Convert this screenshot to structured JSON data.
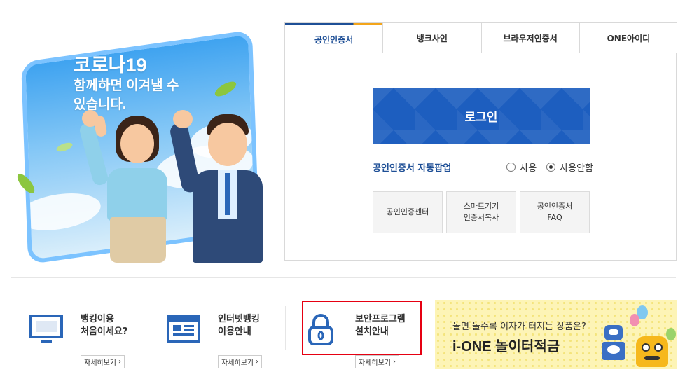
{
  "hero": {
    "line1": "코로나19",
    "line2": "함께하면 이겨낼 수",
    "line3": "있습니다."
  },
  "tabs": [
    {
      "label": "공인인증서",
      "active": true
    },
    {
      "label": "뱅크사인",
      "active": false
    },
    {
      "label": "브라우저인증서",
      "active": false
    },
    {
      "label": "ONE아이디",
      "active": false
    }
  ],
  "login": {
    "button_label": "로그인",
    "autopop_label": "공인인증서 자동팝업",
    "radio_use": "사용",
    "radio_no_use": "사용안함",
    "selected": "사용안함"
  },
  "sub_buttons": [
    {
      "line1": "공인인증센터",
      "line2": ""
    },
    {
      "line1": "스마트기기",
      "line2": "인증서복사"
    },
    {
      "line1": "공인인증서",
      "line2": "FAQ"
    }
  ],
  "guides": [
    {
      "title1": "뱅킹이용",
      "title2": "처음이세요?",
      "more": "자세히보기",
      "icon": "monitor-icon"
    },
    {
      "title1": "인터넷뱅킹",
      "title2": "이용안내",
      "more": "자세히보기",
      "icon": "webpage-icon"
    },
    {
      "title1": "보안프로그램",
      "title2": "설치안내",
      "more": "자세히보기",
      "icon": "padlock-icon"
    }
  ],
  "promo": {
    "subtitle": "놀면 놀수록 이자가 터지는 상품은?",
    "title": "i-ONE 놀이터적금"
  },
  "colors": {
    "brand_blue": "#1e4f96",
    "login_blue": "#1d5ebf",
    "highlight_red": "#e60012",
    "promo_yellow": "#fdf4b6"
  }
}
